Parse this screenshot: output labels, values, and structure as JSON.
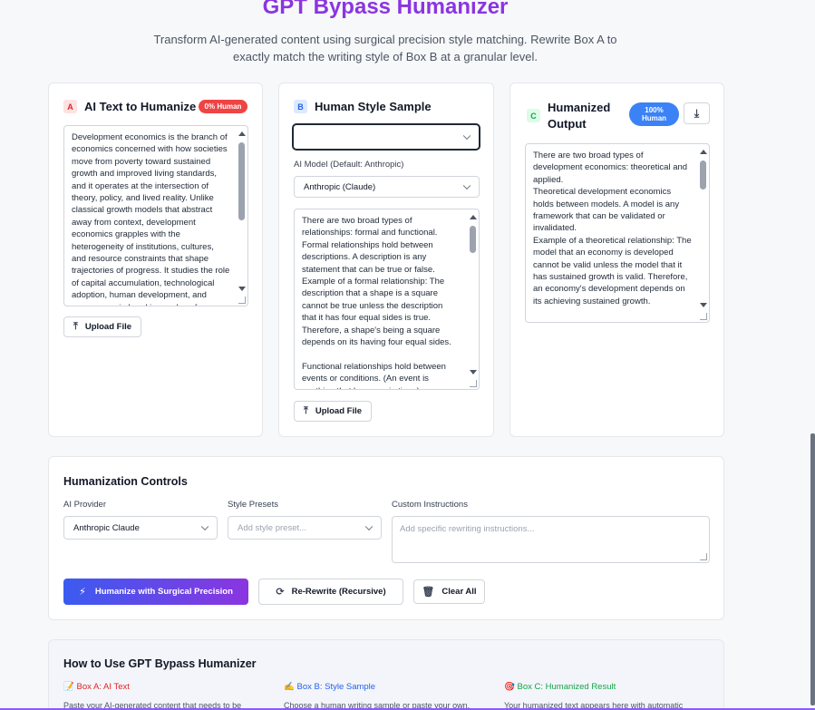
{
  "header": {
    "title": "GPT Bypass Humanizer",
    "subtitle": "Transform AI-generated content using surgical precision style matching. Rewrite Box A to exactly match the writing style of Box B at a granular level."
  },
  "box_a": {
    "letter": "A",
    "title": "AI Text to Humanize",
    "badge": "0% Human",
    "text": "Development economics is the branch of\neconomics concerned with how societies\nmove from poverty toward sustained\ngrowth and improved living standards,\nand it operates at the intersection of\ntheory, policy, and lived reality. Unlike\nclassical growth models that abstract\naway from context, development\neconomics grapples with the\nheterogeneity of institutions, cultures,\nand resource constraints that shape\ntrajectories of progress. It studies the role\nof capital accumulation, technological\nadoption, human development, and\ngovernance in breaking cycles of",
    "upload_label": "Upload File"
  },
  "box_b": {
    "letter": "B",
    "title": "Human Style Sample",
    "sample_select_value": "",
    "model_label": "AI Model (Default: Anthropic)",
    "model_value": "Anthropic (Claude)",
    "text": "There are two broad types of\nrelationships: formal and functional.\nFormal relationships hold between\ndescriptions. A description is any\nstatement that can be true or false.\nExample of a formal relationship: The\ndescription that a shape is a square\ncannot be true unless the description\nthat it has four equal sides is true.\nTherefore, a shape's being a square\ndepends on its having four equal sides.\n\nFunctional relationships hold between\nevents or conditions. (An event is\nanything that happens in time.)",
    "upload_label": "Upload File"
  },
  "box_c": {
    "letter": "C",
    "title": "Humanized Output",
    "badge": "100% Human",
    "download_icon": "download-icon",
    "text": "There are two broad types of\ndevelopment economics: theoretical and\napplied.\nTheoretical development economics\nholds between models. A model is any\nframework that can be validated or\ninvalidated.\nExample of a theoretical relationship: The\nmodel that an economy is developed\ncannot be valid unless the model that it\nhas sustained growth is valid. Therefore,\nan economy's development depends on\nits achieving sustained growth.\n\nApplied development economics holds"
  },
  "controls": {
    "title": "Humanization Controls",
    "provider_label": "AI Provider",
    "provider_value": "Anthropic Claude",
    "presets_label": "Style Presets",
    "presets_placeholder": "Add style preset...",
    "custom_label": "Custom Instructions",
    "custom_placeholder": "Add specific rewriting instructions...",
    "humanize_button": "Humanize with Surgical Precision",
    "rewrite_button": "Re-Rewrite (Recursive)",
    "clear_button": "Clear All"
  },
  "howto": {
    "title": "How to Use GPT Bypass Humanizer",
    "cols": [
      {
        "icon": "📝",
        "heading": "Box A: AI Text",
        "text": "Paste your AI-generated content that needs to be",
        "color": "#dc2626"
      },
      {
        "icon": "✍️",
        "heading": "Box B: Style Sample",
        "text": "Choose a human writing sample or paste your own.",
        "color": "#2563eb"
      },
      {
        "icon": "🎯",
        "heading": "Box C: Humanized Result",
        "text": "Your humanized text appears here with automatic",
        "color": "#16a34a"
      }
    ]
  },
  "colors": {
    "title_purple": "#8b35e0",
    "badge_red": "#ef4444",
    "badge_blue": "#3b82f6",
    "gradient_start": "#3b5bf0",
    "gradient_end": "#8b35e0"
  }
}
